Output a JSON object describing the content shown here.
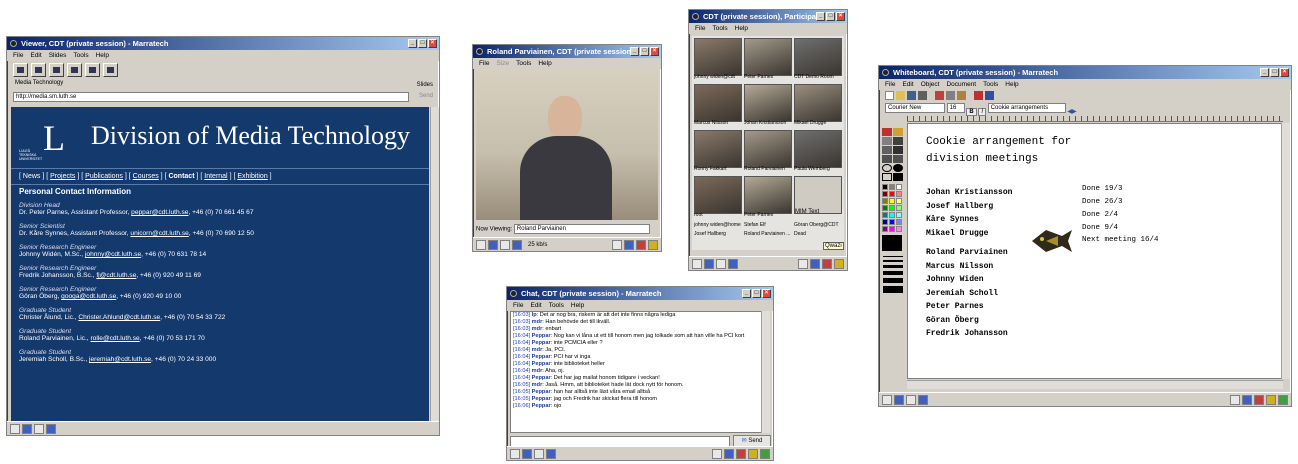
{
  "viewer": {
    "title": "Viewer, CDT (private session) - Marratech",
    "menu": [
      "File",
      "Edit",
      "Slides",
      "Tools",
      "Help"
    ],
    "slide_label": "Media Technology",
    "slides_label": "Slides",
    "url": "http://media.sm.luth.se",
    "send_label": "Send",
    "division": "Division of Media Technology",
    "uni": "LULEÅ TEKNISKA UNIVERSITET",
    "logo": "L",
    "nav": {
      "news": "News",
      "projects": "Projects",
      "publications": "Publications",
      "courses": "Courses",
      "contact": "Contact",
      "internal": "Internal",
      "exhibition": "Exhibition"
    },
    "heading": "Personal Contact Information",
    "people": [
      {
        "role": "Division Head",
        "pre": "Dr. Peter Parnes, Assistant Professor, ",
        "email": "peppar@cdt.luth.se",
        "post": ", +46 (0) 70 661 45 67"
      },
      {
        "role": "Senior Scientist",
        "pre": "Dr. Kåre Synnes, Assistant Professor, ",
        "email": "unicorn@cdt.luth.se",
        "post": ", +46 (0) 70 690 12 50"
      },
      {
        "role": "Senior Research Engineer",
        "pre": "Johnny Widén, M.Sc., ",
        "email": "johnny@cdt.luth.se",
        "post": ", +46 (0) 70 631 78 14"
      },
      {
        "role": "Senior Research Engineer",
        "pre": "Fredrik Johansson, B.Sc., ",
        "email": "fj@cdt.luth.se",
        "post": ", +46 (0) 920 49 11 69"
      },
      {
        "role": "Senior Research Engineer",
        "pre": "Göran Öberg, ",
        "email": "googa@cdt.luth.se",
        "post": ", +46 (0) 920 49 10 00"
      },
      {
        "role": "Graduate Student",
        "pre": "Christer Ålund, Lic., ",
        "email": "Christer.Ahlund@cdt.luth.se",
        "post": ", +46 (0) 70 54 33 722"
      },
      {
        "role": "Graduate Student",
        "pre": "Roland Parviainen, Lic., ",
        "email": "rolle@cdt.luth.se",
        "post": ", +46 (0) 70 53 171 70"
      },
      {
        "role": "Graduate Student",
        "pre": "Jeremiah Scholl, B.Sc., ",
        "email": "jeremiah@cdt.luth.se",
        "post": ", +46 (0) 70 24 33 000"
      }
    ]
  },
  "video": {
    "title": "Roland Parviainen, CDT (private session),...",
    "menu": [
      "File",
      "Size",
      "Tools",
      "Help"
    ],
    "now_viewing_label": "Now Viewing:",
    "now_viewing": "Roland Parviainen",
    "rate": "25 kb/s"
  },
  "participants": {
    "title": "CDT (private session), Participa...",
    "menu": [
      "File",
      "Tools",
      "Help"
    ],
    "rows": [
      [
        "johnny widen@cdt",
        "Peter Parnes",
        "CDT Demo Room"
      ],
      [
        "Marcus Nilsson",
        "Johan Kristiansson",
        "Mikael Drugge"
      ],
      [
        "Ronny Fakkart",
        "Roland Parviainen",
        "Paula Wemberg"
      ],
      [
        "root",
        "Peter Parnes",
        ""
      ],
      [
        "johnny widen@home",
        "Stefan Elf",
        "Göran Öberg@CDT"
      ],
      [
        "Josef Hallberg",
        "Roland Parviainen ...",
        "Dead"
      ]
    ],
    "mim_text": "MIM Text",
    "qwazi": "Qwazi"
  },
  "chat": {
    "title": "Chat, CDT (private session) - Marratech",
    "menu": [
      "File",
      "Edit",
      "Tools",
      "Help"
    ],
    "send": "Send",
    "lines": [
      {
        "t": "[16:03]",
        "n": "lp",
        "m": "Det ar nog bra, riskern är att det inte finns några lediga"
      },
      {
        "t": "[16:03]",
        "n": "mdr",
        "m": "Han behövde det till ikväll."
      },
      {
        "t": "[16:03]",
        "n": "mdr",
        "m": "enbart"
      },
      {
        "t": "[16:04]",
        "n": "Peppar",
        "m": "Nog kan vi låna ut ett till honom men jag tolkade som att han ville ha PCI kort"
      },
      {
        "t": "[16:04]",
        "n": "Peppar",
        "m": "inte PCMCIA eller ?"
      },
      {
        "t": "[16:04]",
        "n": "mdr",
        "m": "Ja, PCI."
      },
      {
        "t": "[16:04]",
        "n": "Peppar",
        "m": "PCI har vi inga"
      },
      {
        "t": "[16:04]",
        "n": "Peppar",
        "m": "inte biblioteket heller"
      },
      {
        "t": "[16:04]",
        "n": "mdr",
        "m": "Aha, oj."
      },
      {
        "t": "[16:04]",
        "n": "Peppar",
        "m": "Det har jag mailat honom tidigare i veckan!"
      },
      {
        "t": "[16:05]",
        "n": "mdr",
        "m": "Jaså. Hmm, att biblioteket hade lät dock nytt för honom."
      },
      {
        "t": "[16:05]",
        "n": "Peppar",
        "m": "han har alltså inte läst våra email alltså"
      },
      {
        "t": "[16:05]",
        "n": "Peppar",
        "m": "jag och Fredrik har skickat flera till honom"
      },
      {
        "t": "[16:06]",
        "n": "Peppar",
        "m": "ojo"
      }
    ]
  },
  "whiteboard": {
    "title": "Whiteboard, CDT (private session) - Marratech",
    "menu": [
      "File",
      "Edit",
      "Object",
      "Document",
      "Tools",
      "Help"
    ],
    "font": "Courier New",
    "size": "16",
    "page_title": "Cookie arrangements",
    "bold": "B",
    "italic": "I",
    "heading1": "Cookie arrangement for",
    "heading2": "division meetings",
    "names1": [
      "Johan Kristiansson",
      "Josef Hallberg",
      "Kåre Synnes",
      "Mikael Drugge"
    ],
    "done": [
      "Done 19/3",
      "Done 26/3",
      "Done 2/4",
      "Done 9/4"
    ],
    "next": "Next meeting 16/4",
    "names2": [
      "Roland Parviainen",
      "Marcus Nilsson",
      "Johnny Widen",
      "Jeremiah Scholl",
      "Peter Parnes",
      "Göran Öberg",
      "Fredrik Johansson"
    ]
  }
}
